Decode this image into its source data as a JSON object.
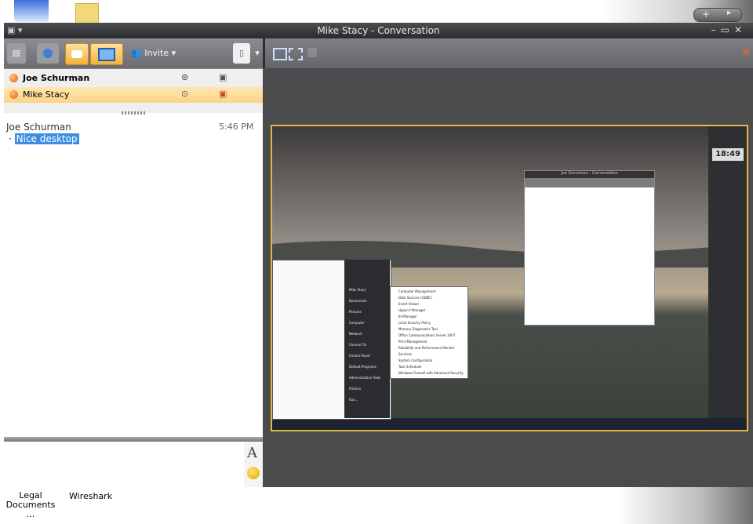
{
  "window": {
    "title": "Mike Stacy - Conversation"
  },
  "toolbar": {
    "invite_label": "Invite"
  },
  "participants": [
    {
      "name": "Joe Schurman"
    },
    {
      "name": "Mike Stacy"
    }
  ],
  "conversation": {
    "messages": [
      {
        "sender": "Joe Schurman",
        "time": "5:46 PM",
        "text": "Nice desktop"
      }
    ]
  },
  "desktop_shortcuts": [
    "Legal Documents ...",
    "Wireshark"
  ],
  "shared_desktop": {
    "clock": "18:49",
    "inner_window_title": "Joe Schurman - Conversation",
    "start_menu_items": [
      "Mike Stacy",
      "Documents",
      "Pictures",
      "Computer",
      "Network",
      "Connect To",
      "Control Panel",
      "Default Programs",
      "Administrative Tools",
      "Printers",
      "Run..."
    ],
    "admin_tools": [
      "Computer Management",
      "Data Sources (ODBC)",
      "Event Viewer",
      "Hyper-V Manager",
      "IIS Manager",
      "Local Security Policy",
      "Memory Diagnostics Tool",
      "Office Communications Server 2007",
      "Print Management",
      "Reliability and Performance Monitor",
      "Services",
      "System Configuration",
      "Task Scheduler",
      "Windows Firewall with Advanced Security"
    ]
  }
}
